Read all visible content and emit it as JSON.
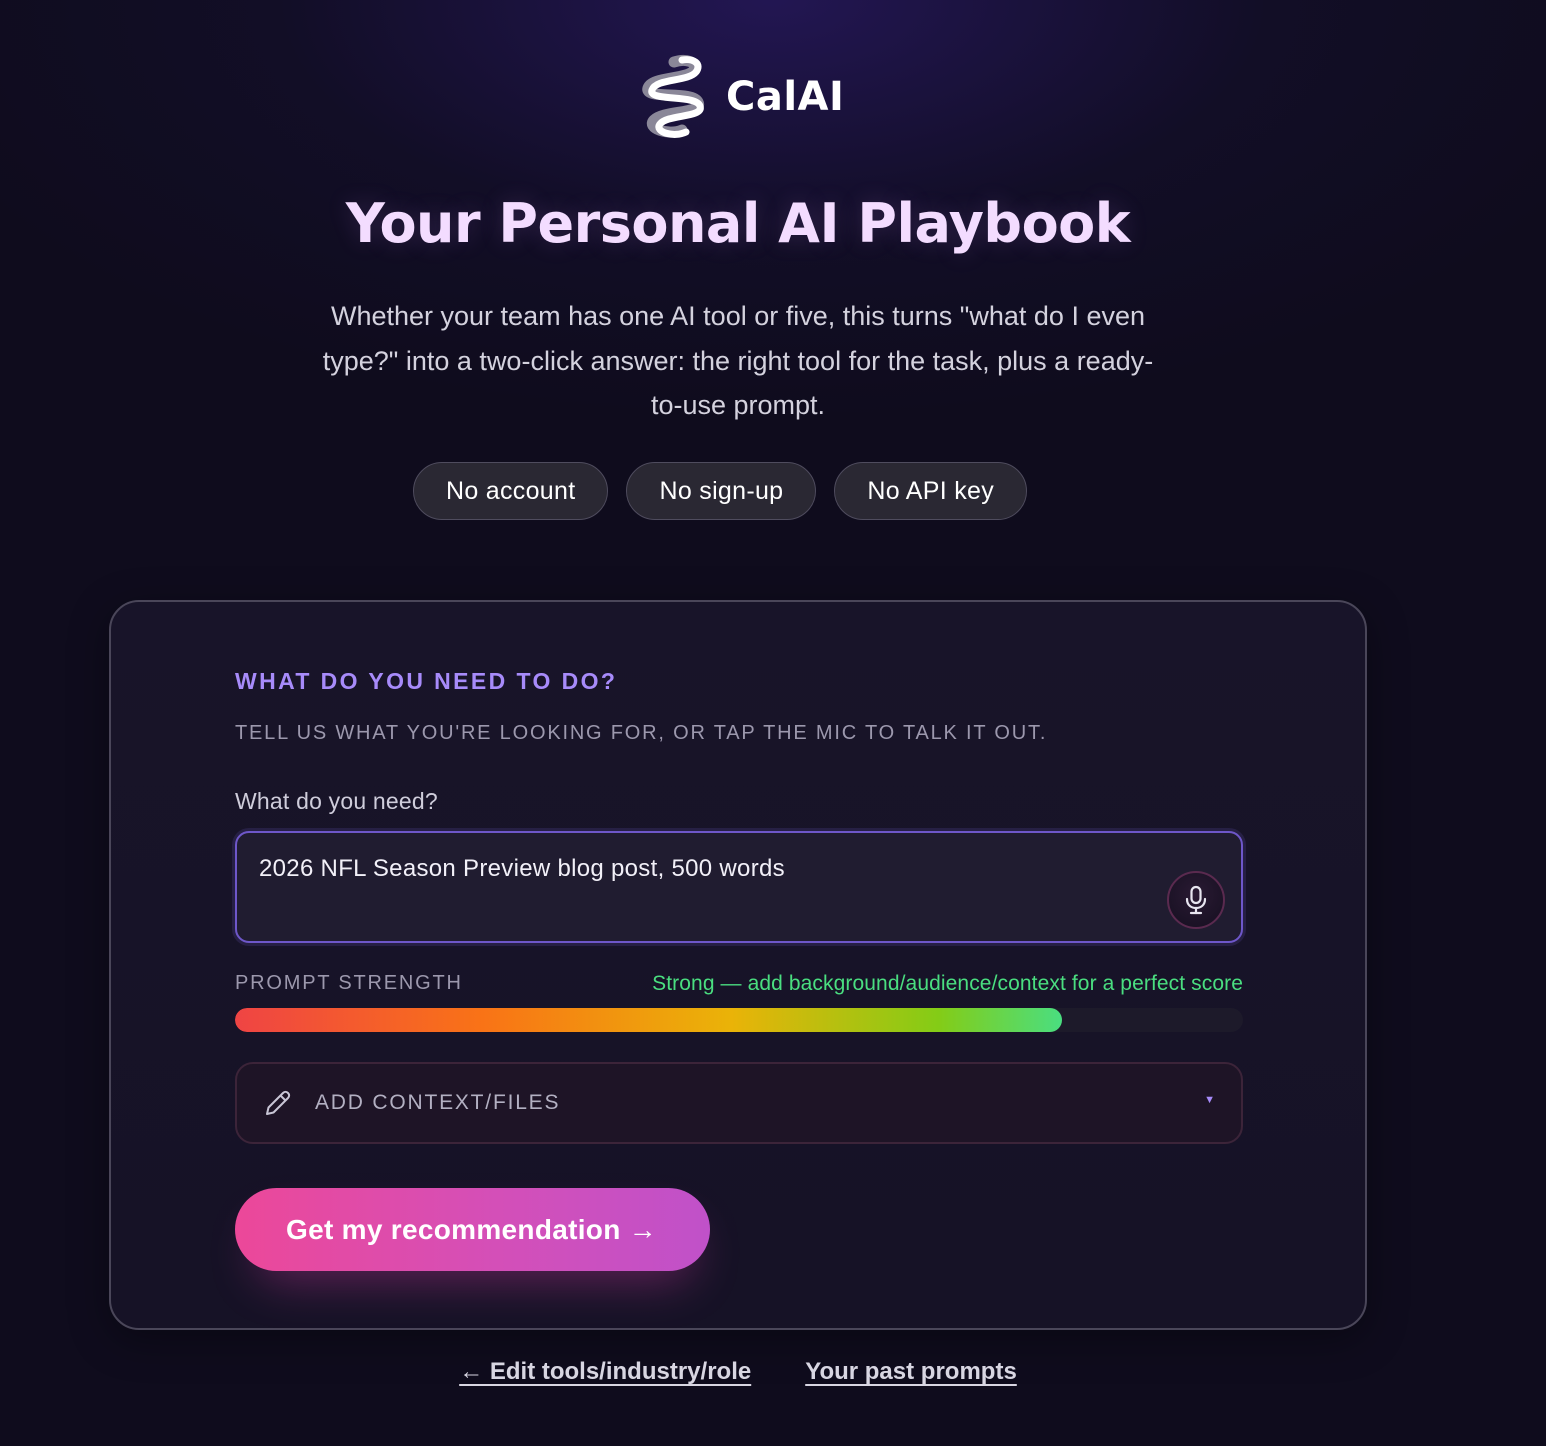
{
  "brand": {
    "name": "CalAI",
    "logo_icon": "snake-coil-logo"
  },
  "hero": {
    "title": "Your Personal AI Playbook",
    "subtitle": "Whether your team has one AI tool or five, this turns \"what do I even type?\" into a two-click answer: the right tool for the task, plus a ready-to-use prompt."
  },
  "badges": [
    "No account",
    "No sign-up",
    "No API key"
  ],
  "card": {
    "section_title": "WHAT DO YOU NEED TO DO?",
    "section_subtitle": "TELL US WHAT YOU'RE LOOKING FOR, OR TAP THE MIC TO TALK IT OUT.",
    "need_label": "What do you need?",
    "need_value": "2026 NFL Season Preview blog post, 500 words",
    "mic_icon": "microphone-icon",
    "strength": {
      "label": "PROMPT STRENGTH",
      "message": "Strong — add background/audience/context for a perfect score",
      "level_percent": 82,
      "message_color": "#4ade80"
    },
    "context": {
      "label": "ADD CONTEXT/FILES",
      "icon": "pencil-icon",
      "caret": "▼"
    },
    "cta_label": "Get my recommendation →"
  },
  "footer": {
    "edit_link": "← Edit tools/industry/role",
    "past_link": "Your past prompts"
  },
  "colors": {
    "accent": "#a78bfa",
    "cta_start": "#ec4899",
    "cta_end": "#c051c9",
    "title": "#f3dcff",
    "background": "#0f0c1d"
  }
}
